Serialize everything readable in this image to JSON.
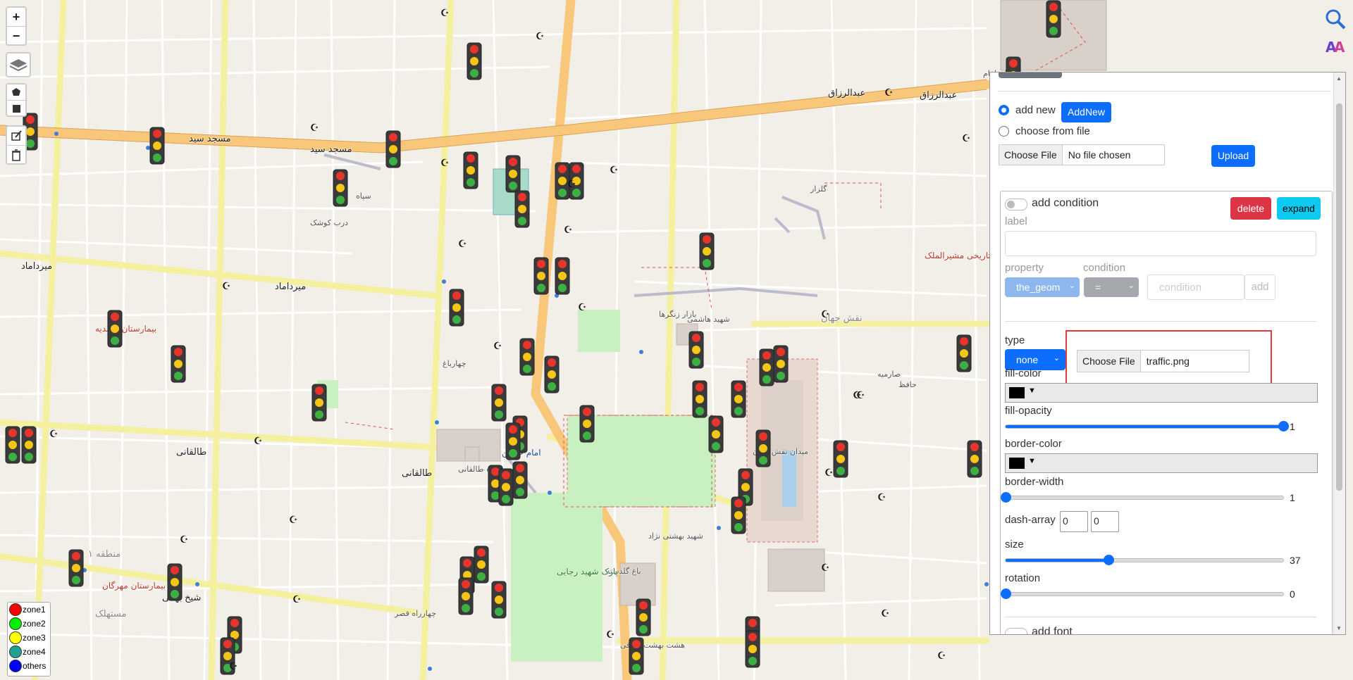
{
  "map": {
    "labels": [
      "مسجد سید",
      "مسجد سید",
      "عبدالرزاق",
      "عبدالرزاق",
      "میدان امام",
      "میرداماد",
      "میرداماد",
      "طالقانی",
      "طالقانی",
      "چهارراه طالقانی",
      "شیخ بهائی",
      "چهارراه قصر",
      "باغ گلدسته",
      "پارک شهید رجایی",
      "میدان نقش جهان",
      "امام حسین",
      "هشت بهشت شرقی",
      "شهید بهشتی نژاد",
      "حافظ",
      "نقش جهان",
      "گلزار",
      "شهید هاشمی",
      "بازار زنگرها",
      "بیمارستان احمدیه",
      "بیمارستان مهرگان",
      "منطقه ۱",
      "مستهلک",
      "خانه تاریخی مشیرالملک",
      "سپاه",
      "چهارباغ",
      "صارمیه",
      "درب کوشک"
    ]
  },
  "controls": {
    "zoom_in": "+",
    "zoom_out": "−"
  },
  "legend": [
    {
      "label": "zone1",
      "color": "#ff0000"
    },
    {
      "label": "zone2",
      "color": "#00ee00"
    },
    {
      "label": "zone3",
      "color": "#ffff00"
    },
    {
      "label": "zone4",
      "color": "#20a090"
    },
    {
      "label": "others",
      "color": "#0000ff"
    }
  ],
  "panel": {
    "add_new_label": "add new",
    "add_new_button": "AddNew",
    "choose_file_label": "choose from file",
    "file_button": "Choose File",
    "file_status": "No file chosen",
    "upload_button": "Upload",
    "add_condition_label": "add condition",
    "delete_button": "delete",
    "expand_button": "expand",
    "label_label": "label",
    "property_label": "property",
    "condition_label": "condition",
    "property_value": "the_geom",
    "condition_value": "=",
    "condition_placeholder": "condition",
    "add_button": "add",
    "type_label": "type",
    "type_value": "none",
    "icon_file_button": "Choose File",
    "icon_file_name": "traffic.png",
    "fill_color_label": "fill-color",
    "fill_opacity_label": "fill-opacity",
    "fill_opacity_value": "1",
    "border_color_label": "border-color",
    "border_width_label": "border-width",
    "border_width_value": "1",
    "dash_array_label": "dash-array",
    "dash_array_1": "0",
    "dash_array_2": "0",
    "size_label": "size",
    "size_value": "37",
    "rotation_label": "rotation",
    "rotation_value": "0",
    "add_font_label": "add font",
    "fill_color": "#000000",
    "border_color": "#000000",
    "fill_opacity_level": 1.0,
    "border_width_level": 0.0,
    "size_level": 0.37,
    "rotation_level": 0.0
  }
}
